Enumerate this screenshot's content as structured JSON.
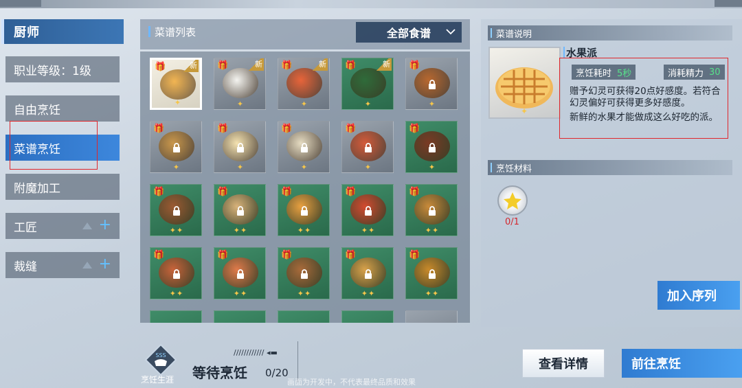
{
  "sidebar": {
    "title": "厨师",
    "tabs": [
      {
        "label": "职业等级：1级"
      },
      {
        "label": "自由烹饪"
      },
      {
        "label": "菜谱烹饪"
      },
      {
        "label": "附魔加工"
      },
      {
        "label": "工匠"
      },
      {
        "label": "裁缝"
      }
    ]
  },
  "recipe_list": {
    "title": "菜谱列表",
    "filter": "全部食谱",
    "new_badge": "新",
    "items": [
      {
        "icon": "fruit-pie-icon",
        "state": "selected",
        "new": true
      },
      {
        "icon": "rice-ball-icon",
        "state": "available",
        "new": true
      },
      {
        "icon": "grilled-fish-icon",
        "state": "available",
        "new": true
      },
      {
        "icon": "leaf-wrap-icon",
        "state": "available",
        "new": true
      },
      {
        "icon": "roast-chicken-icon",
        "state": "locked"
      },
      {
        "icon": "sandwich-icon",
        "state": "locked"
      },
      {
        "icon": "fried-egg-icon",
        "state": "locked"
      },
      {
        "icon": "tofu-soup-icon",
        "state": "locked"
      },
      {
        "icon": "shrimp-plate-icon",
        "state": "locked"
      },
      {
        "icon": "stew-icon",
        "state": "locked"
      },
      {
        "icon": "skewers-icon",
        "state": "locked"
      },
      {
        "icon": "dumpling-steamer-icon",
        "state": "locked"
      },
      {
        "icon": "sushi-board-icon",
        "state": "locked"
      },
      {
        "icon": "tomato-dish-icon",
        "state": "locked"
      },
      {
        "icon": "bread-rolls-icon",
        "state": "locked"
      },
      {
        "icon": "grilled-fish-plate-icon",
        "state": "locked"
      },
      {
        "icon": "sashimi-icon",
        "state": "locked"
      },
      {
        "icon": "seafood-platter-icon",
        "state": "locked"
      },
      {
        "icon": "fries-platter-icon",
        "state": "locked"
      },
      {
        "icon": "tea-drink-icon",
        "state": "locked"
      }
    ]
  },
  "detail": {
    "section_title": "菜谱说明",
    "recipe_name": "水果派",
    "time_label": "烹饪耗时",
    "time_value": "5秒",
    "energy_label": "消耗精力",
    "energy_value": "30",
    "description_1": "赠予幻灵可获得20点好感度。若符合幻灵偏好可获得更多好感度。",
    "description_2": "新鲜的水果才能做成这么好吃的派。",
    "materials_title": "烹饪材料",
    "material_count": "0/1",
    "add_queue_button": "加入序列"
  },
  "bottom": {
    "career_label": "烹饪生涯",
    "career_badge": "SSS",
    "status": "等待烹饪",
    "queue_count": "0/20",
    "details_button": "查看详情",
    "go_cook_button": "前往烹饪",
    "footnote": "画面为开发中，不代表最终品质和效果"
  },
  "colors": {
    "accent_blue": "#3d87dc",
    "highlight_red": "#e0262b",
    "value_green": "#58e28a",
    "plus_blue": "#63c1ff"
  }
}
